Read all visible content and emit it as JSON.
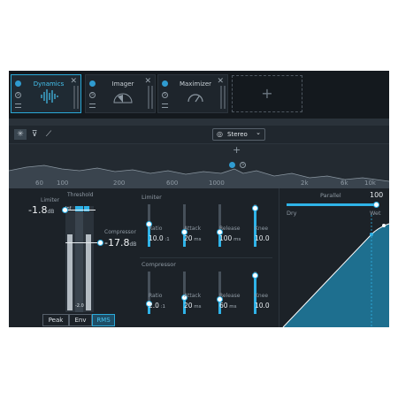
{
  "modules": [
    {
      "title": "Dynamics",
      "close": "✕",
      "active": true
    },
    {
      "title": "Imager",
      "close": "✕",
      "active": false
    },
    {
      "title": "Maximizer",
      "close": "✕",
      "active": false
    }
  ],
  "add_module": "+",
  "stereo_select": {
    "value": "Stereo",
    "arrow": "⌄"
  },
  "spectrum": {
    "add": "+",
    "freqs": [
      "60",
      "100",
      "200",
      "600",
      "1000",
      "2k",
      "6k",
      "10k"
    ]
  },
  "threshold_label": "Threshold",
  "limiter": {
    "label": "Limiter",
    "value": "-1.8",
    "unit": "dB"
  },
  "compressor": {
    "label": "Compressor",
    "value": "-17.8",
    "unit": "dB"
  },
  "meter_readout": "-2.0",
  "meter_top": "Inf",
  "detection_modes": [
    "Peak",
    "Env",
    "RMS"
  ],
  "detection_selected": "RMS",
  "limiter_params": {
    "title": "Limiter",
    "params": [
      {
        "label": "Ratio",
        "value": "10.0",
        "unit": ":1",
        "level": 0.55
      },
      {
        "label": "Attack",
        "value": "20",
        "unit": "ms",
        "level": 0.35
      },
      {
        "label": "Release",
        "value": "100",
        "unit": "ms",
        "level": 0.35
      },
      {
        "label": "Knee",
        "value": "10.0",
        "unit": "",
        "level": 0.92
      }
    ]
  },
  "compressor_params": {
    "title": "Compressor",
    "params": [
      {
        "label": "Ratio",
        "value": "2.0",
        "unit": ":1",
        "level": 0.25
      },
      {
        "label": "Attack",
        "value": "20",
        "unit": "ms",
        "level": 0.4
      },
      {
        "label": "Release",
        "value": "60",
        "unit": "ms",
        "level": 0.35
      },
      {
        "label": "Knee",
        "value": "10.0",
        "unit": "",
        "level": 0.92
      }
    ]
  },
  "parallel": {
    "label": "Parallel",
    "value": "100",
    "dry": "Dry",
    "wet": "Wet",
    "level": 1.0
  },
  "colors": {
    "accent": "#2fb3e8",
    "panel": "#1b2128"
  }
}
